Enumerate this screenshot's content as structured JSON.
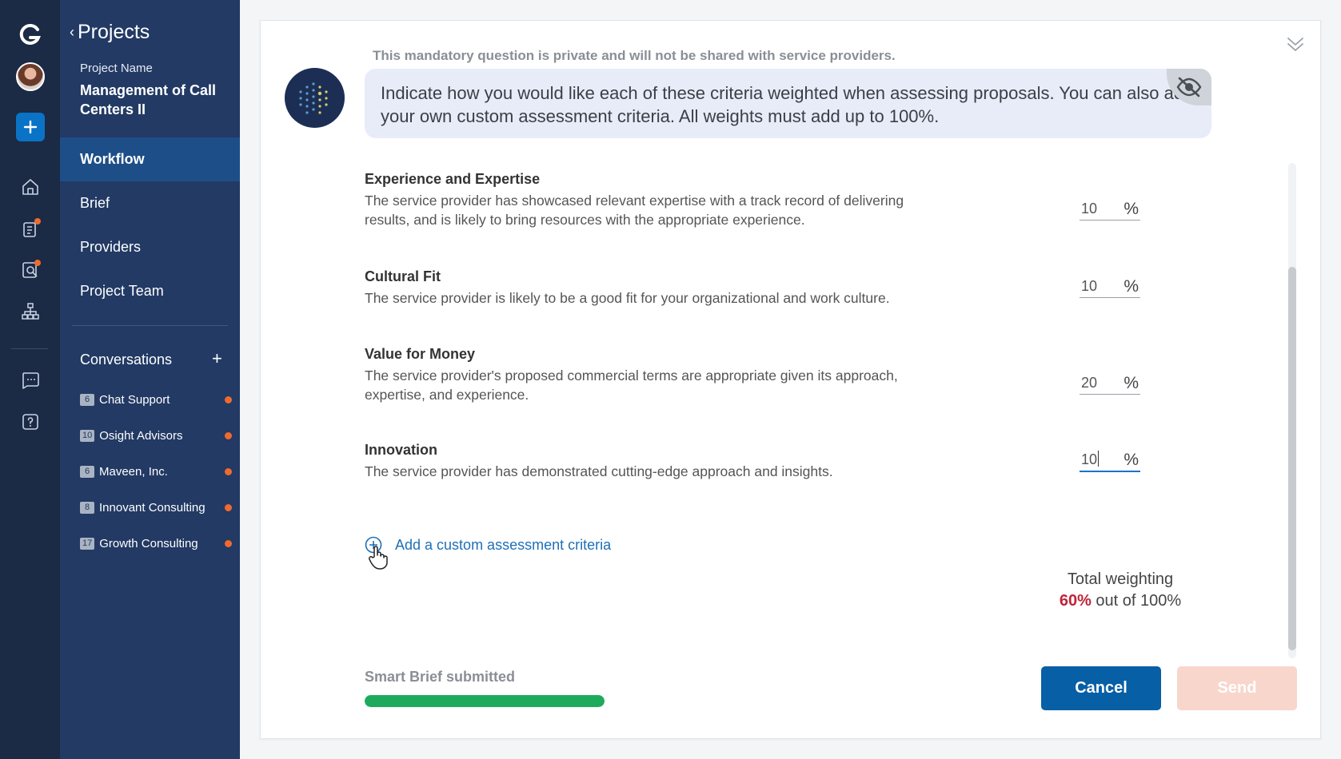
{
  "rail": {
    "icons": [
      "g-logo-icon",
      "user-avatar",
      "plus-icon",
      "home-icon",
      "clipboard-icon",
      "search-doc-icon",
      "org-chart-icon",
      "chat-icon",
      "help-icon"
    ]
  },
  "sidebar": {
    "back_label": "Projects",
    "project_label": "Project Name",
    "project_name": "Management of Call Centers II",
    "nav": [
      {
        "label": "Workflow",
        "active": true
      },
      {
        "label": "Brief",
        "active": false
      },
      {
        "label": "Providers",
        "active": false
      },
      {
        "label": "Project Team",
        "active": false
      }
    ],
    "conversations_label": "Conversations",
    "conversations": [
      {
        "count": "6",
        "name": "Chat Support"
      },
      {
        "count": "10",
        "name": "Osight Advisors"
      },
      {
        "count": "6",
        "name": "Maveen, Inc."
      },
      {
        "count": "8",
        "name": "Innovant Consulting"
      },
      {
        "count": "17",
        "name": "Growth Consulting"
      }
    ]
  },
  "main": {
    "private_note": "This mandatory question is private and will not be shared with service providers.",
    "question": "Indicate how you would like each of these criteria weighted when assessing proposals. You can also add your own custom assessment criteria. All weights must add up to 100%.",
    "criteria": [
      {
        "title": "Experience and Expertise",
        "desc": "The service provider has showcased relevant expertise with a track record of delivering results, and is likely to bring resources with the appropriate experience.",
        "weight": "10",
        "unit": "%"
      },
      {
        "title": "Cultural Fit",
        "desc": "The service provider is likely to be a good fit for your organizational and work culture.",
        "weight": "10",
        "unit": "%"
      },
      {
        "title": "Value for Money",
        "desc": "The service provider's proposed commercial terms are appropriate given its approach, expertise, and experience.",
        "weight": "20",
        "unit": "%"
      },
      {
        "title": "Innovation",
        "desc": "The service provider has demonstrated cutting-edge approach and insights.",
        "weight": "10",
        "unit": "%"
      }
    ],
    "add_custom_label": "Add a custom assessment criteria",
    "total_label": "Total weighting",
    "total_value": "60%",
    "total_suffix": "out of 100%",
    "status_label": "Smart Brief submitted",
    "status_progress": 1.0,
    "cancel_label": "Cancel",
    "send_label": "Send"
  },
  "colors": {
    "rail_bg": "#1b2a45",
    "sidebar_bg": "#223a64",
    "active_nav": "#1e4e88",
    "accent": "#075fa6",
    "badge": "#f06a2e",
    "total_red": "#c0243a",
    "progress_green": "#1eaa5c"
  }
}
